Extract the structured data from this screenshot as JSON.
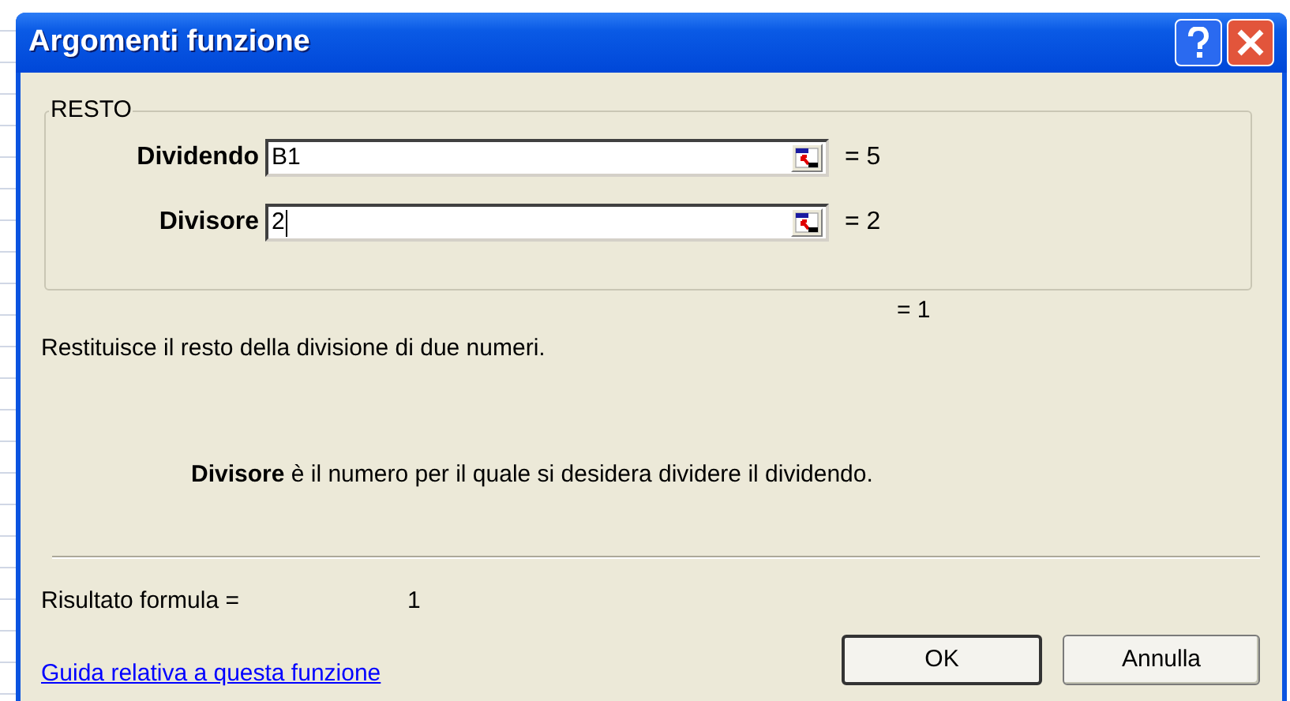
{
  "window": {
    "title": "Argomenti funzione"
  },
  "group": {
    "label": "RESTO",
    "arguments": [
      {
        "label": "Dividendo",
        "value": "B1",
        "result": "= 5",
        "focused": false
      },
      {
        "label": "Divisore",
        "value": "2",
        "result": "= 2",
        "focused": true
      }
    ]
  },
  "function_result": "= 1",
  "description": "Restituisce il resto della divisione di due numeri.",
  "argument_help": "**Divisore** è il numero per il quale si desidera dividere il dividendo.",
  "formula_result": {
    "label": "Risultato formula =",
    "value": "1"
  },
  "help_link": "Guida relativa a questa funzione",
  "buttons": [
    "OK",
    "Annulla"
  ]
}
